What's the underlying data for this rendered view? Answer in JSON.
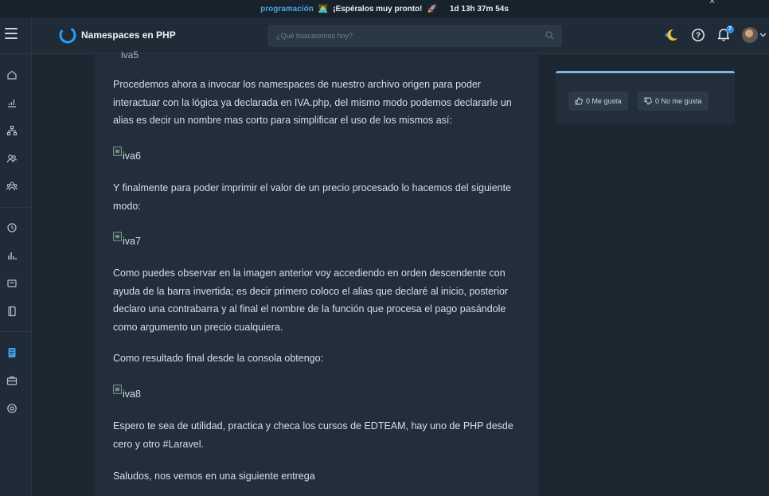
{
  "promo": {
    "highlight": "programación",
    "emoji1": "👨‍💻",
    "text": "¡Espéralos muy pronto!",
    "emoji2": "🚀",
    "countdown": "1d 13h 37m 54s"
  },
  "header": {
    "title": "Namespaces en PHP",
    "search_placeholder": "¿Qué buscaremos hoy?",
    "notification_count": "7"
  },
  "article": {
    "cutoff_text": "iva5",
    "paragraphs": [
      "Procedemos ahora a invocar los namespaces de nuestro archivo origen para poder interactuar con la lógica ya declarada en IVA.php, del mismo modo podemos declararle un alias es decir un nombre mas corto para simplificar el uso de los mismos así:",
      "Y finalmente para poder imprimir el valor de un precio procesado lo hacemos del siguiente modo:",
      "Como puedes observar en la imagen anterior voy accediendo en orden descendente con ayuda de la barra invertida; es decir primero coloco el alias que declaré al inicio, posterior declaro una contrabarra y al final el nombre de la función que procesa el pago pasándole como argumento un precio cualquiera.",
      "Como resultado final desde la consola obtengo:",
      "Espero te sea de utilidad, practica y checa los cursos de EDTEAM, hay uno de PHP  desde cero y otro #Laravel.",
      "Saludos, nos vemos en una siguiente entrega"
    ],
    "images": [
      "iva6",
      "iva7",
      "iva8"
    ]
  },
  "reactions": {
    "like": "0 Me gusta",
    "dislike": "0 No me gusta"
  },
  "colors": {
    "background": "#1c2731",
    "panel": "#222f3b",
    "accent": "#2f8ee0",
    "widget_border": "#7fb7e8"
  }
}
